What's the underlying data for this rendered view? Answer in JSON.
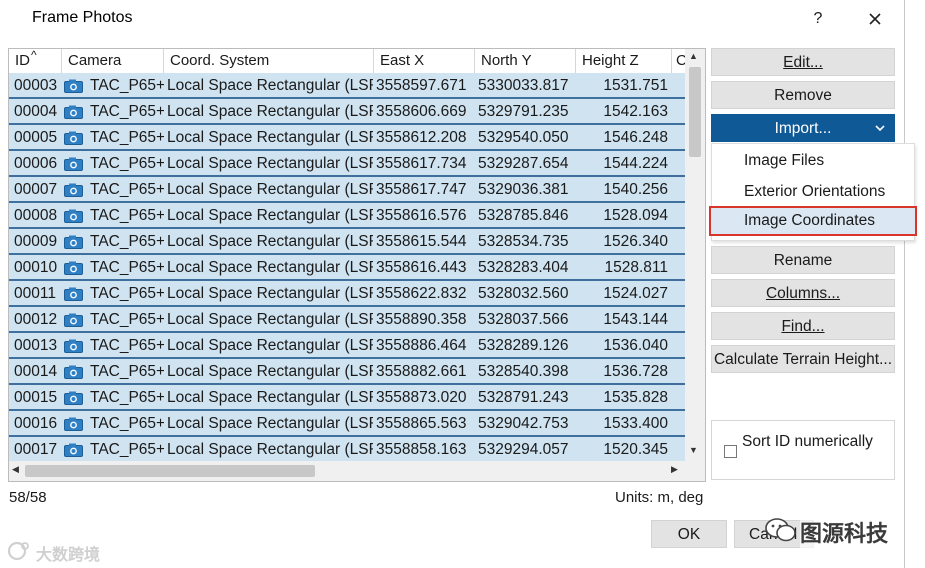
{
  "window": {
    "title": "Frame Photos",
    "help_label": "?"
  },
  "table": {
    "columns": [
      "ID",
      "Camera",
      "Coord. System",
      "East X",
      "North Y",
      "Height Z",
      "C"
    ],
    "sort_indicator": "^",
    "rows": [
      {
        "id": "00003",
        "camera": "TAC_P65+",
        "coord": "Local Space Rectangular (LSR)",
        "east": "3558597.671",
        "north": "5330033.817",
        "height": "1531.751"
      },
      {
        "id": "00004",
        "camera": "TAC_P65+",
        "coord": "Local Space Rectangular (LSR)",
        "east": "3558606.669",
        "north": "5329791.235",
        "height": "1542.163"
      },
      {
        "id": "00005",
        "camera": "TAC_P65+",
        "coord": "Local Space Rectangular (LSR)",
        "east": "3558612.208",
        "north": "5329540.050",
        "height": "1546.248"
      },
      {
        "id": "00006",
        "camera": "TAC_P65+",
        "coord": "Local Space Rectangular (LSR)",
        "east": "3558617.734",
        "north": "5329287.654",
        "height": "1544.224"
      },
      {
        "id": "00007",
        "camera": "TAC_P65+",
        "coord": "Local Space Rectangular (LSR)",
        "east": "3558617.747",
        "north": "5329036.381",
        "height": "1540.256"
      },
      {
        "id": "00008",
        "camera": "TAC_P65+",
        "coord": "Local Space Rectangular (LSR)",
        "east": "3558616.576",
        "north": "5328785.846",
        "height": "1528.094"
      },
      {
        "id": "00009",
        "camera": "TAC_P65+",
        "coord": "Local Space Rectangular (LSR)",
        "east": "3558615.544",
        "north": "5328534.735",
        "height": "1526.340"
      },
      {
        "id": "00010",
        "camera": "TAC_P65+",
        "coord": "Local Space Rectangular (LSR)",
        "east": "3558616.443",
        "north": "5328283.404",
        "height": "1528.811"
      },
      {
        "id": "00011",
        "camera": "TAC_P65+",
        "coord": "Local Space Rectangular (LSR)",
        "east": "3558622.832",
        "north": "5328032.560",
        "height": "1524.027"
      },
      {
        "id": "00012",
        "camera": "TAC_P65+",
        "coord": "Local Space Rectangular (LSR)",
        "east": "3558890.358",
        "north": "5328037.566",
        "height": "1543.144"
      },
      {
        "id": "00013",
        "camera": "TAC_P65+",
        "coord": "Local Space Rectangular (LSR)",
        "east": "3558886.464",
        "north": "5328289.126",
        "height": "1536.040"
      },
      {
        "id": "00014",
        "camera": "TAC_P65+",
        "coord": "Local Space Rectangular (LSR)",
        "east": "3558882.661",
        "north": "5328540.398",
        "height": "1536.728"
      },
      {
        "id": "00015",
        "camera": "TAC_P65+",
        "coord": "Local Space Rectangular (LSR)",
        "east": "3558873.020",
        "north": "5328791.243",
        "height": "1535.828"
      },
      {
        "id": "00016",
        "camera": "TAC_P65+",
        "coord": "Local Space Rectangular (LSR)",
        "east": "3558865.563",
        "north": "5329042.753",
        "height": "1533.400"
      },
      {
        "id": "00017",
        "camera": "TAC_P65+",
        "coord": "Local Space Rectangular (LSR)",
        "east": "3558858.163",
        "north": "5329294.057",
        "height": "1520.345"
      }
    ]
  },
  "actions": {
    "edit": "Edit...",
    "remove": "Remove",
    "import": "Import...",
    "rename": "Rename",
    "columns": "Columns...",
    "find": "Find...",
    "calc_terrain": "Calculate Terrain Height..."
  },
  "import_menu": {
    "items": [
      "Image Files",
      "Exterior Orientations",
      "Image Coordinates"
    ],
    "highlighted": "Image Coordinates"
  },
  "sort_option": {
    "label": "Sort ID numerically",
    "checked": false
  },
  "status": {
    "count": "58/58",
    "units": "Units: m, deg"
  },
  "footer": {
    "ok": "OK",
    "cancel": "Cancel"
  },
  "watermarks": {
    "right_text": "图源科技",
    "left_text": "大数跨境"
  },
  "colors": {
    "row_selected": "#cfe3f1",
    "row_border": "#3f6f9c",
    "primary_button": "#0f5996",
    "highlight_outline": "#d9362b"
  }
}
